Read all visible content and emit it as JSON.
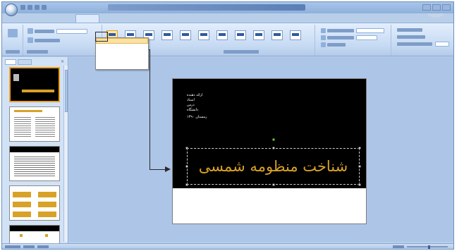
{
  "colors": {
    "ribbon_blue": "#c6daf3",
    "workspace_blue": "#adc5e7",
    "slide_bg": "#000000",
    "title_gold": "#d8a227",
    "selection_orange": "#fbe2a2"
  },
  "icons": {
    "office_button": "office-button-icon",
    "save": "save-icon",
    "undo": "undo-icon",
    "redo": "redo-icon"
  },
  "ribbon": {
    "active_tab_index": 3
  },
  "dropdown": {
    "selected_index": 0
  },
  "slide": {
    "info_lines": [
      "ارائه دهنده",
      "استاد",
      "درس",
      "دانشگاه",
      "زمستان ۱۳۹۰"
    ],
    "title": "شناخت منظومه شمسی"
  },
  "thumbnails": {
    "count": 6,
    "selected_index": 0
  },
  "zoom_level_fraction": 0.55
}
